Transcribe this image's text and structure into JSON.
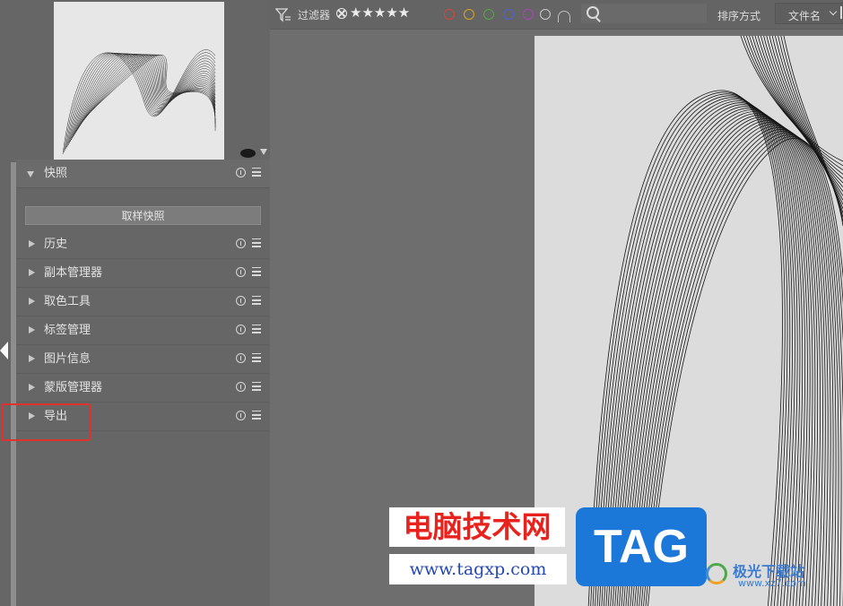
{
  "toolbar": {
    "filter_label": "过滤器",
    "stars": "★★★★★",
    "color_labels": [
      {
        "name": "red",
        "color": "#e0433c"
      },
      {
        "name": "yellow",
        "color": "#d8a623"
      },
      {
        "name": "green",
        "color": "#53a748"
      },
      {
        "name": "blue",
        "color": "#4a64d6"
      },
      {
        "name": "purple",
        "color": "#b244c2"
      },
      {
        "name": "gray",
        "color": "#c9c9c9"
      }
    ],
    "search_placeholder": "",
    "sort_label": "排序方式",
    "sort_value": "文件名"
  },
  "panel": {
    "snapshot": {
      "title": "快照",
      "take_button": "取样快照"
    },
    "modules": [
      {
        "label": "历史"
      },
      {
        "label": "副本管理器"
      },
      {
        "label": "取色工具"
      },
      {
        "label": "标签管理"
      },
      {
        "label": "图片信息"
      },
      {
        "label": "蒙版管理器"
      },
      {
        "label": "导出"
      }
    ]
  },
  "watermark": {
    "title": "电脑技术网",
    "url": "www.tagxp.com",
    "tag": "TAG",
    "corner_text": "极光下载站",
    "corner_url": "www.xz7.com"
  },
  "colors": {
    "highlight": "#e0322b",
    "panel": "#666666",
    "image_bg": "#dcdcdc"
  }
}
